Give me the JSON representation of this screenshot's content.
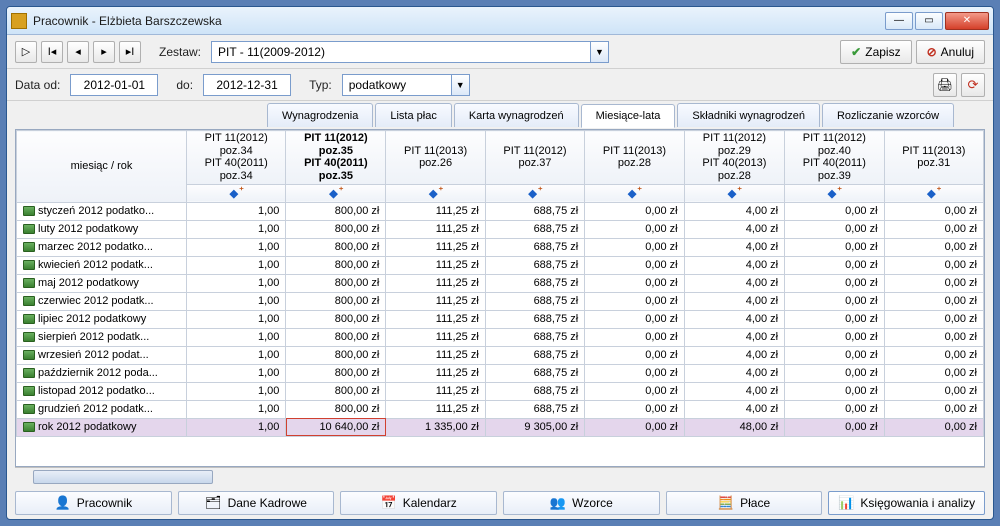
{
  "window": {
    "title": "Pracownik - Elżbieta Barszczewska"
  },
  "toolbar": {
    "zestaw_label": "Zestaw:",
    "zestaw_value": "PIT - 11(2009-2012)",
    "save_label": "Zapisz",
    "cancel_label": "Anuluj",
    "date_from_label": "Data od:",
    "date_from_value": "2012-01-01",
    "date_to_label": "do:",
    "date_to_value": "2012-12-31",
    "type_label": "Typ:",
    "type_value": "podatkowy"
  },
  "tabs": {
    "items": [
      {
        "label": "Wynagrodzenia"
      },
      {
        "label": "Lista płac"
      },
      {
        "label": "Karta wynagrodzeń"
      },
      {
        "label": "Miesiące-lata"
      },
      {
        "label": "Składniki wynagrodzeń"
      },
      {
        "label": "Rozliczanie wzorców"
      }
    ],
    "active_index": 3
  },
  "grid": {
    "row_header": "miesiąc / rok",
    "columns": [
      "PIT 11(2012) poz.34 PIT 40(2011) poz.34",
      "PIT 11(2012) poz.35 PIT 40(2011) poz.35",
      "PIT 11(2013) poz.26",
      "PIT 11(2012) poz.37",
      "PIT 11(2013) poz.28",
      "PIT 11(2012) poz.29 PIT 40(2013) poz.28",
      "PIT 11(2012) poz.40 PIT 40(2011) poz.39",
      "PIT 11(2013) poz.31"
    ],
    "selected_col_index": 1,
    "rows": [
      {
        "label": "styczeń 2012 podatko...",
        "cells": [
          "1,00",
          "800,00 zł",
          "111,25 zł",
          "688,75 zł",
          "0,00 zł",
          "4,00 zł",
          "0,00 zł",
          "0,00 zł"
        ]
      },
      {
        "label": "luty 2012 podatkowy",
        "cells": [
          "1,00",
          "800,00 zł",
          "111,25 zł",
          "688,75 zł",
          "0,00 zł",
          "4,00 zł",
          "0,00 zł",
          "0,00 zł"
        ]
      },
      {
        "label": "marzec 2012 podatko...",
        "cells": [
          "1,00",
          "800,00 zł",
          "111,25 zł",
          "688,75 zł",
          "0,00 zł",
          "4,00 zł",
          "0,00 zł",
          "0,00 zł"
        ]
      },
      {
        "label": "kwiecień 2012 podatk...",
        "cells": [
          "1,00",
          "800,00 zł",
          "111,25 zł",
          "688,75 zł",
          "0,00 zł",
          "4,00 zł",
          "0,00 zł",
          "0,00 zł"
        ]
      },
      {
        "label": "maj 2012 podatkowy",
        "cells": [
          "1,00",
          "800,00 zł",
          "111,25 zł",
          "688,75 zł",
          "0,00 zł",
          "4,00 zł",
          "0,00 zł",
          "0,00 zł"
        ]
      },
      {
        "label": "czerwiec 2012 podatk...",
        "cells": [
          "1,00",
          "800,00 zł",
          "111,25 zł",
          "688,75 zł",
          "0,00 zł",
          "4,00 zł",
          "0,00 zł",
          "0,00 zł"
        ]
      },
      {
        "label": "lipiec 2012 podatkowy",
        "cells": [
          "1,00",
          "800,00 zł",
          "111,25 zł",
          "688,75 zł",
          "0,00 zł",
          "4,00 zł",
          "0,00 zł",
          "0,00 zł"
        ]
      },
      {
        "label": "sierpień 2012 podatk...",
        "cells": [
          "1,00",
          "800,00 zł",
          "111,25 zł",
          "688,75 zł",
          "0,00 zł",
          "4,00 zł",
          "0,00 zł",
          "0,00 zł"
        ]
      },
      {
        "label": "wrzesień 2012 podat...",
        "cells": [
          "1,00",
          "800,00 zł",
          "111,25 zł",
          "688,75 zł",
          "0,00 zł",
          "4,00 zł",
          "0,00 zł",
          "0,00 zł"
        ]
      },
      {
        "label": "październik 2012 poda...",
        "cells": [
          "1,00",
          "800,00 zł",
          "111,25 zł",
          "688,75 zł",
          "0,00 zł",
          "4,00 zł",
          "0,00 zł",
          "0,00 zł"
        ]
      },
      {
        "label": "listopad 2012 podatko...",
        "cells": [
          "1,00",
          "800,00 zł",
          "111,25 zł",
          "688,75 zł",
          "0,00 zł",
          "4,00 zł",
          "0,00 zł",
          "0,00 zł"
        ]
      },
      {
        "label": "grudzień 2012 podatk...",
        "cells": [
          "1,00",
          "800,00 zł",
          "111,25 zł",
          "688,75 zł",
          "0,00 zł",
          "4,00 zł",
          "0,00 zł",
          "0,00 zł"
        ]
      }
    ],
    "summary": {
      "label": "rok 2012 podatkowy",
      "cells": [
        "1,00",
        "10 640,00 zł",
        "1 335,00 zł",
        "9 305,00 zł",
        "0,00 zł",
        "48,00 zł",
        "0,00 zł",
        "0,00 zł"
      ],
      "highlight_cell_index": 1
    }
  },
  "bottom_tabs": {
    "items": [
      {
        "label": "Pracownik",
        "icon": "👤"
      },
      {
        "label": "Dane Kadrowe",
        "icon": "🗂"
      },
      {
        "label": "Kalendarz",
        "icon": "📅"
      },
      {
        "label": "Wzorce",
        "icon": "👥"
      },
      {
        "label": "Płace",
        "icon": "🧮"
      },
      {
        "label": "Księgowania i analizy",
        "icon": "📊"
      }
    ],
    "active_index": 5
  }
}
